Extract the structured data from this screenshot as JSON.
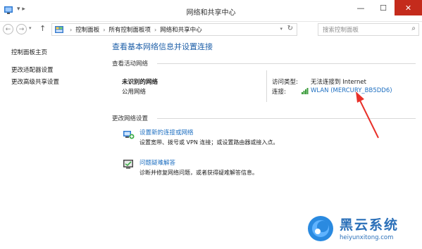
{
  "window": {
    "title": "网络和共享中心",
    "minimize_glyph": "—",
    "maximize_glyph": "☐",
    "close_glyph": "✕",
    "quick_access": "▾ ▸"
  },
  "navigation": {
    "back_glyph": "←",
    "forward_glyph": "→",
    "dropdown_glyph": "▾",
    "up_glyph": "↑",
    "breadcrumbs": [
      "控制面板",
      "所有控制面板项",
      "网络和共享中心"
    ],
    "separator": "›",
    "refresh_glyph": "↻",
    "search_placeholder": "搜索控制面板",
    "search_glyph": "⌕"
  },
  "sidebar": {
    "items": [
      {
        "label": "控制面板主页"
      },
      {
        "label": "更改适配器设置"
      },
      {
        "label": "更改高级共享设置"
      }
    ]
  },
  "main": {
    "heading": "查看基本网络信息并设置连接",
    "active_networks_label": "查看活动网络",
    "network": {
      "name": "未识别的网络",
      "type": "公用网络",
      "access_type_label": "访问类型:",
      "access_type_value": "无法连接到 Internet",
      "connections_label": "连接:",
      "connection_value": "WLAN (MERCURY_BB5DD6)"
    },
    "change_settings_label": "更改网络设置",
    "tasks": [
      {
        "title": "设置新的连接或网络",
        "description": "设置宽带、拨号或 VPN 连接；或设置路由器或接入点。",
        "icon": "network-setup-icon"
      },
      {
        "title": "问题疑难解答",
        "description": "诊断并修复网络问题，或者获得疑难解答信息。",
        "icon": "troubleshoot-icon"
      }
    ]
  },
  "watermark": {
    "title": "黑云系统",
    "url": "heiyunxitong.com"
  },
  "colors": {
    "link": "#1e6fc1",
    "heading": "#1e5fa8",
    "close": "#c42b1c",
    "annotation_arrow": "#e8312a"
  }
}
